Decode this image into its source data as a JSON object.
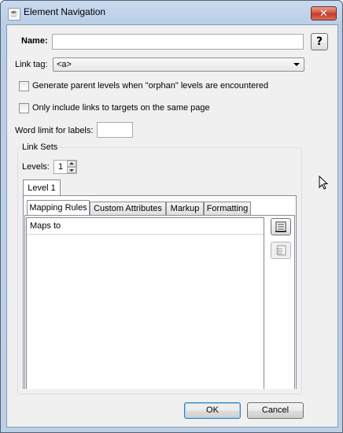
{
  "window": {
    "title": "Element Navigation",
    "app_icon": "java-cup-icon",
    "close_glyph": "✕"
  },
  "form": {
    "name_label": "Name:",
    "name_value": "",
    "help_label": "?",
    "link_tag_label": "Link tag:",
    "link_tag_value": "<a>",
    "orphan_checkbox_label": "Generate parent levels when \"orphan\" levels are encountered",
    "orphan_checked": false,
    "same_page_checkbox_label": "Only include links to targets on the same page",
    "same_page_checked": false,
    "word_limit_label": "Word limit for labels:",
    "word_limit_value": ""
  },
  "link_sets": {
    "group_title": "Link Sets",
    "levels_label": "Levels:",
    "levels_value": "1",
    "level_tab": "Level 1",
    "inner_tabs": [
      "Mapping Rules",
      "Custom Attributes",
      "Markup",
      "Formatting"
    ],
    "active_inner_tab": "Mapping Rules",
    "list_header": "Maps to",
    "rows": []
  },
  "buttons": {
    "ok": "OK",
    "cancel": "Cancel"
  },
  "colors": {
    "titlebar": "#b9cee7",
    "close": "#c63a27",
    "client": "#f0f0f0"
  }
}
